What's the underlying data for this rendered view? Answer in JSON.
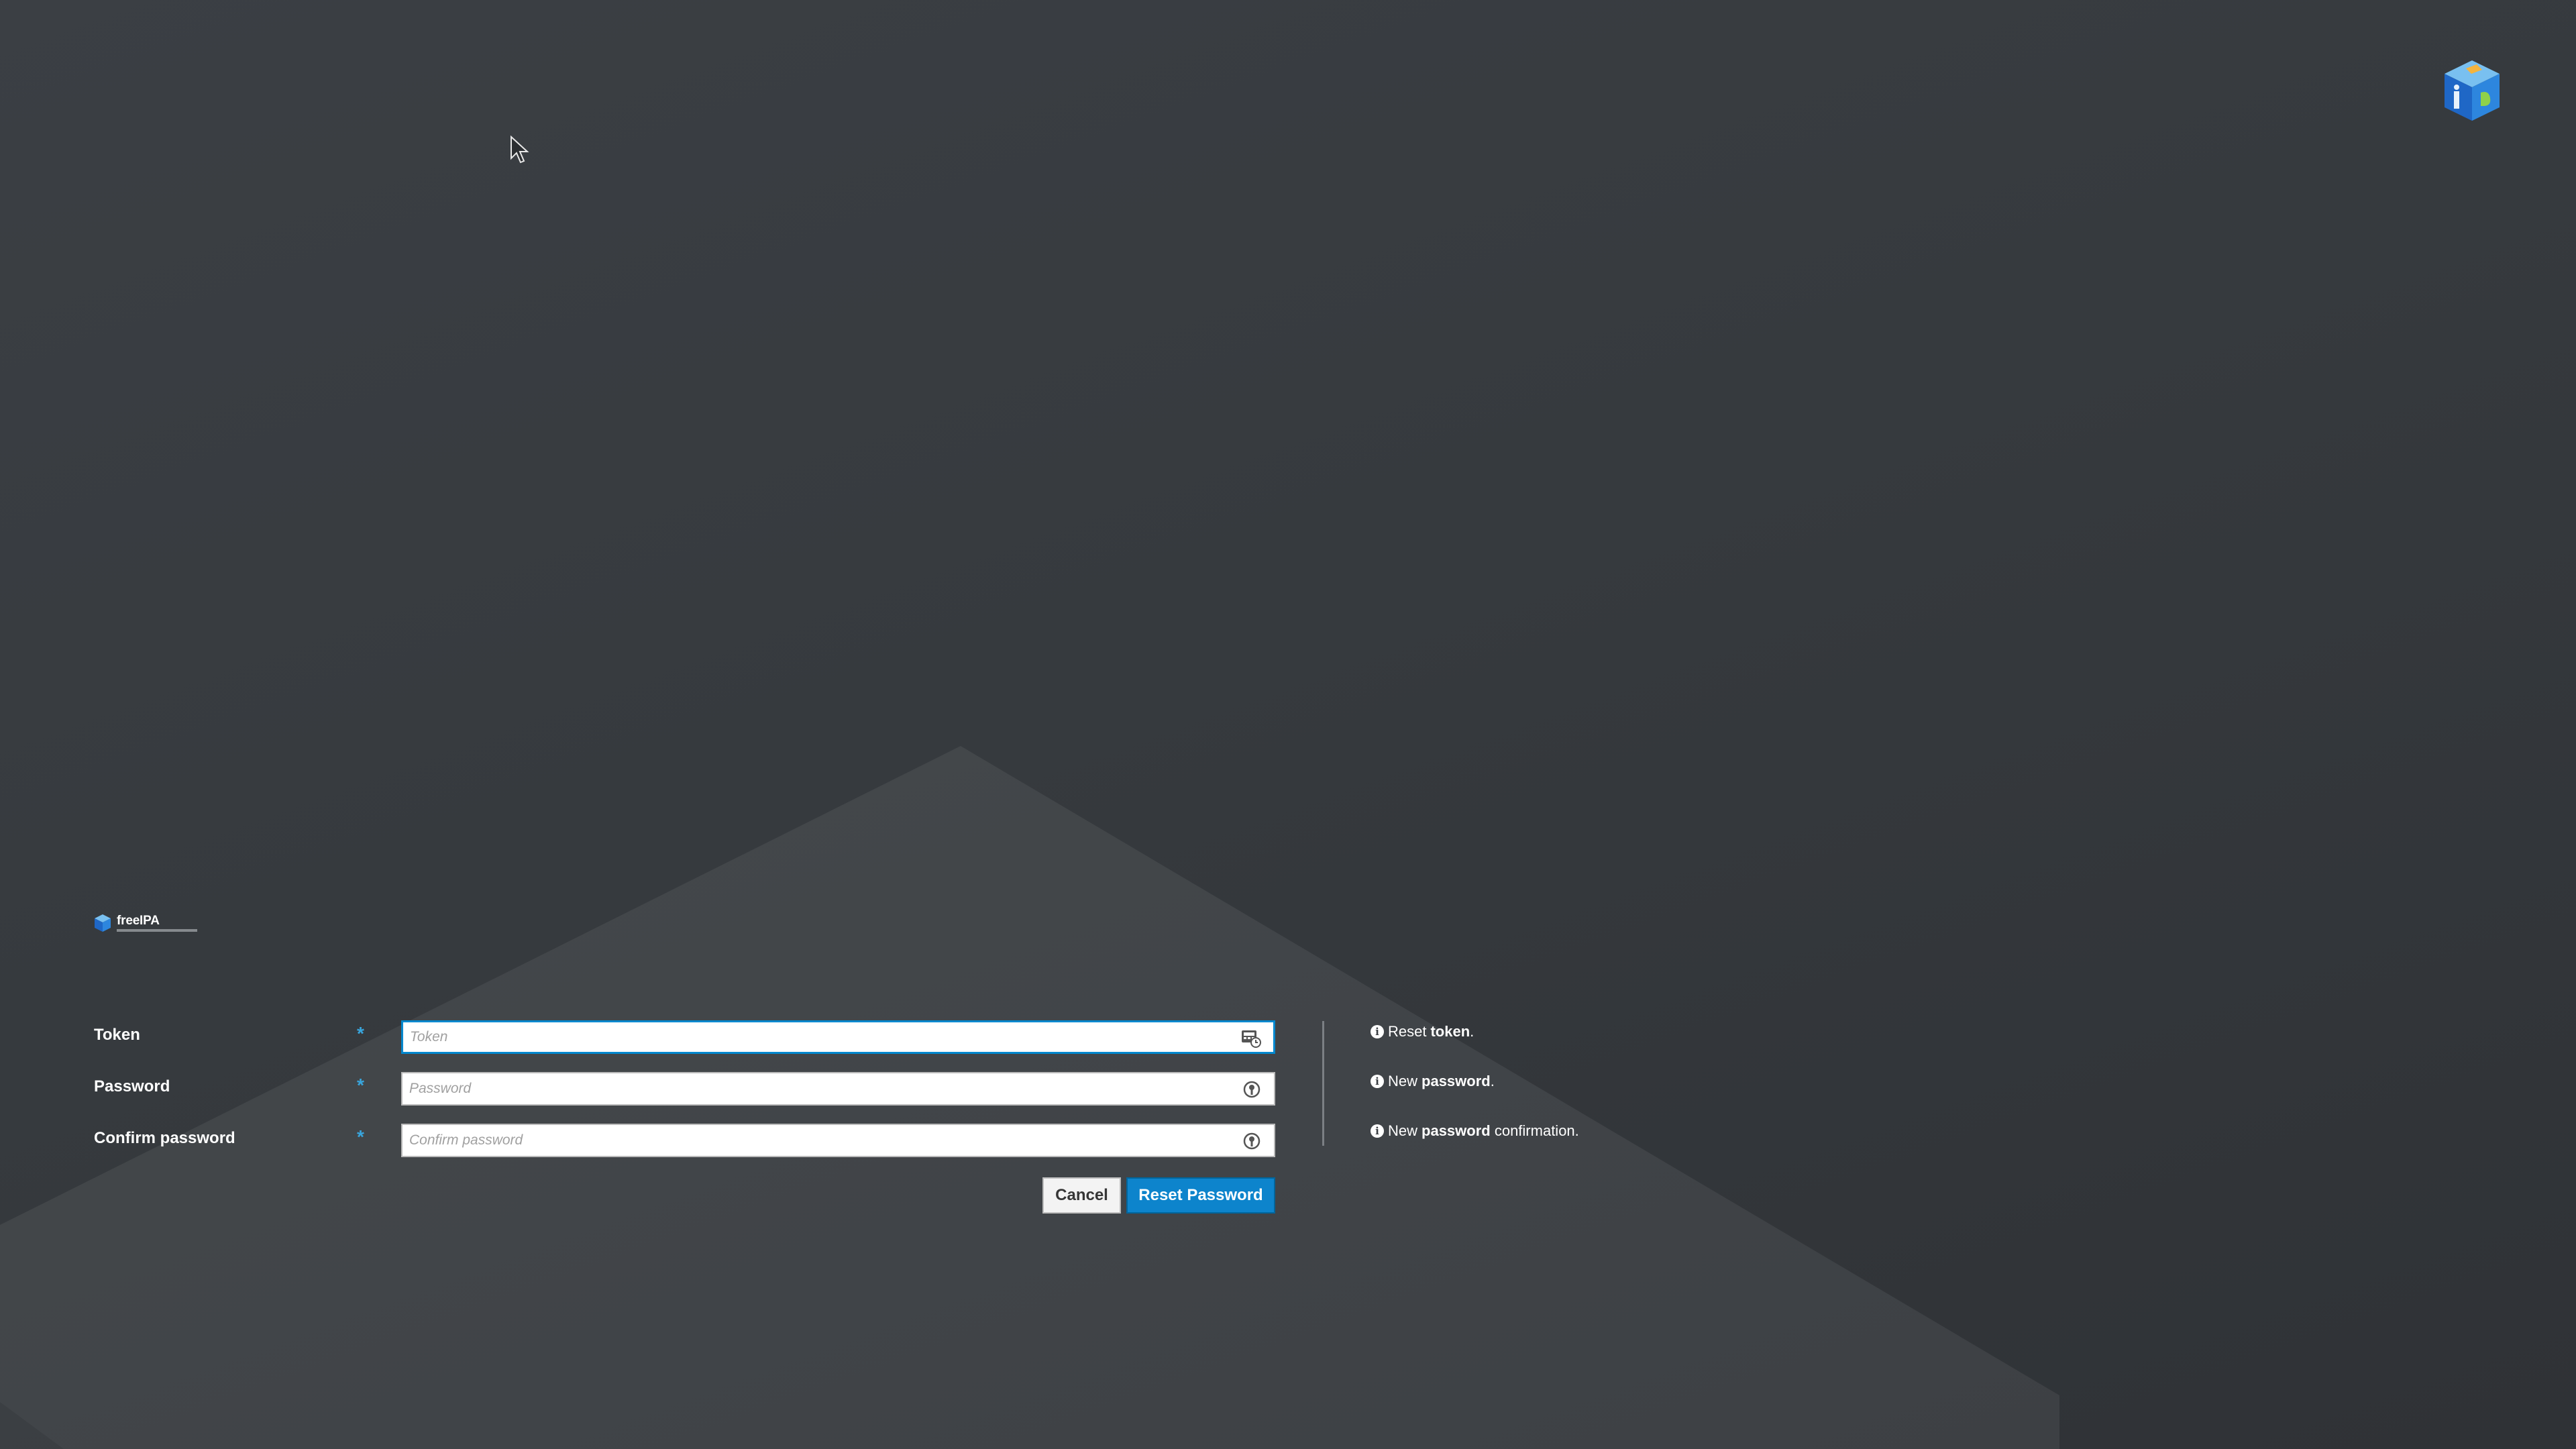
{
  "brand": {
    "name": "freeIPA"
  },
  "form": {
    "fields": [
      {
        "label": "Token",
        "placeholder": "Token",
        "icon": "otp-token-icon",
        "required": true,
        "focused": true
      },
      {
        "label": "Password",
        "placeholder": "Password",
        "icon": "password-key-icon",
        "required": true,
        "focused": false
      },
      {
        "label": "Confirm password",
        "placeholder": "Confirm password",
        "icon": "password-key-icon",
        "required": true,
        "focused": false
      }
    ],
    "required_marker": "*"
  },
  "help": [
    {
      "prefix": "Reset",
      "bold": "token",
      "suffix": "."
    },
    {
      "prefix": "New",
      "bold": "password",
      "suffix": "."
    },
    {
      "prefix": "New",
      "bold": "password",
      "suffix": " confirmation."
    }
  ],
  "actions": {
    "cancel_label": "Cancel",
    "reset_label": "Reset Password"
  },
  "colors": {
    "background": "#373b3f",
    "accent": "#39a5dc",
    "primary_button": "#0d84cc"
  },
  "icons": {
    "corner_logo": "freeipa-cube-logo",
    "cursor": "mouse-pointer-icon",
    "info": "info-circle-icon"
  }
}
